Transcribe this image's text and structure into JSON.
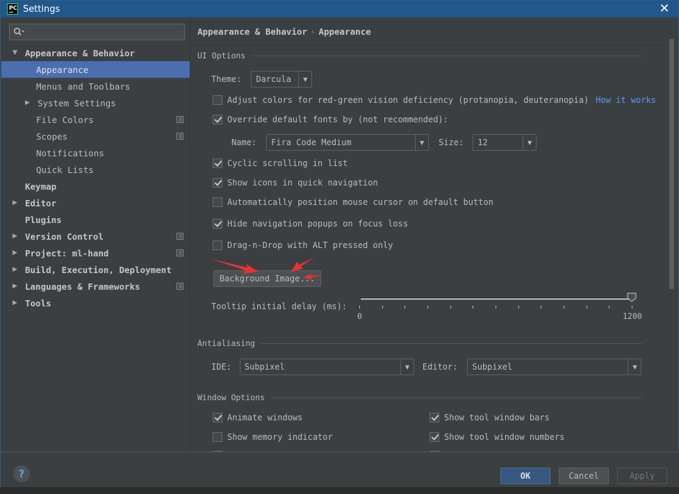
{
  "window": {
    "title": "Settings",
    "app_icon": "PC",
    "close_icon": "close-icon"
  },
  "sidebar": {
    "search": {
      "placeholder": "",
      "value": ""
    },
    "items": [
      {
        "label": "Appearance & Behavior",
        "level": 0,
        "expandable": true,
        "expanded": true,
        "bold": true,
        "project_icon": false,
        "selected": false
      },
      {
        "label": "Appearance",
        "level": 1,
        "expandable": false,
        "bold": false,
        "project_icon": false,
        "selected": true
      },
      {
        "label": "Menus and Toolbars",
        "level": 1,
        "expandable": false,
        "bold": false,
        "project_icon": false,
        "selected": false
      },
      {
        "label": "System Settings",
        "level": 1,
        "expandable": true,
        "expanded": false,
        "bold": false,
        "project_icon": false,
        "selected": false
      },
      {
        "label": "File Colors",
        "level": 1,
        "expandable": false,
        "bold": false,
        "project_icon": true,
        "selected": false
      },
      {
        "label": "Scopes",
        "level": 1,
        "expandable": false,
        "bold": false,
        "project_icon": true,
        "selected": false
      },
      {
        "label": "Notifications",
        "level": 1,
        "expandable": false,
        "bold": false,
        "project_icon": false,
        "selected": false
      },
      {
        "label": "Quick Lists",
        "level": 1,
        "expandable": false,
        "bold": false,
        "project_icon": false,
        "selected": false
      },
      {
        "label": "Keymap",
        "level": 0,
        "expandable": false,
        "bold": true,
        "project_icon": false,
        "selected": false
      },
      {
        "label": "Editor",
        "level": 0,
        "expandable": true,
        "expanded": false,
        "bold": true,
        "project_icon": false,
        "selected": false
      },
      {
        "label": "Plugins",
        "level": 0,
        "expandable": false,
        "bold": true,
        "project_icon": false,
        "selected": false
      },
      {
        "label": "Version Control",
        "level": 0,
        "expandable": true,
        "expanded": false,
        "bold": true,
        "project_icon": true,
        "selected": false
      },
      {
        "label": "Project: ml-hand",
        "level": 0,
        "expandable": true,
        "expanded": false,
        "bold": true,
        "project_icon": true,
        "selected": false
      },
      {
        "label": "Build, Execution, Deployment",
        "level": 0,
        "expandable": true,
        "expanded": false,
        "bold": true,
        "project_icon": false,
        "selected": false
      },
      {
        "label": "Languages & Frameworks",
        "level": 0,
        "expandable": true,
        "expanded": false,
        "bold": true,
        "project_icon": true,
        "selected": false
      },
      {
        "label": "Tools",
        "level": 0,
        "expandable": true,
        "expanded": false,
        "bold": true,
        "project_icon": false,
        "selected": false
      }
    ]
  },
  "main": {
    "breadcrumb": [
      "Appearance & Behavior",
      "Appearance"
    ],
    "breadcrumb_separator": "›",
    "ui_options": {
      "title": "UI Options",
      "theme_label": "Theme:",
      "theme_value": "Darcula",
      "color_deficiency": {
        "label": "Adjust colors for red-green vision deficiency (protanopia, deuteranopia)",
        "checked": false,
        "link": "How it works"
      },
      "override_fonts": {
        "label": "Override default fonts by (not recommended):",
        "checked": true
      },
      "font_name_label": "Name:",
      "font_name_value": "Fira Code Medium",
      "font_size_label": "Size:",
      "font_size_value": "12",
      "checkboxes": [
        {
          "label": "Cyclic scrolling in list",
          "checked": true
        },
        {
          "label": "Show icons in quick navigation",
          "checked": true
        },
        {
          "label": "Automatically position mouse cursor on default button",
          "checked": false
        },
        {
          "label": "Hide navigation popups on focus loss",
          "checked": true
        },
        {
          "label": "Drag-n-Drop with ALT pressed only",
          "checked": false
        }
      ],
      "background_image_button": "Background Image...",
      "tooltip_delay": {
        "label": "Tooltip initial delay (ms):",
        "min_label": "0",
        "max_label": "1200",
        "min": 0,
        "max": 1200,
        "value": 1200,
        "tick_count": 13
      }
    },
    "antialiasing": {
      "title": "Antialiasing",
      "ide_label": "IDE:",
      "ide_value": "Subpixel",
      "editor_label": "Editor:",
      "editor_value": "Subpixel"
    },
    "window_options": {
      "title": "Window Options",
      "left": [
        {
          "label": "Animate windows",
          "checked": true
        },
        {
          "label": "Show memory indicator",
          "checked": false
        }
      ],
      "right": [
        {
          "label": "Show tool window bars",
          "checked": true
        },
        {
          "label": "Show tool window numbers",
          "checked": true
        }
      ]
    }
  },
  "footer": {
    "help_label": "?",
    "ok_label": "OK",
    "cancel_label": "Cancel",
    "apply_label": "Apply"
  },
  "colors": {
    "titlebar": "#21578a",
    "selection": "#4b6eaf",
    "link": "#589df6",
    "ok_button": "#365880",
    "annotation_arrow": "#e8322f"
  }
}
